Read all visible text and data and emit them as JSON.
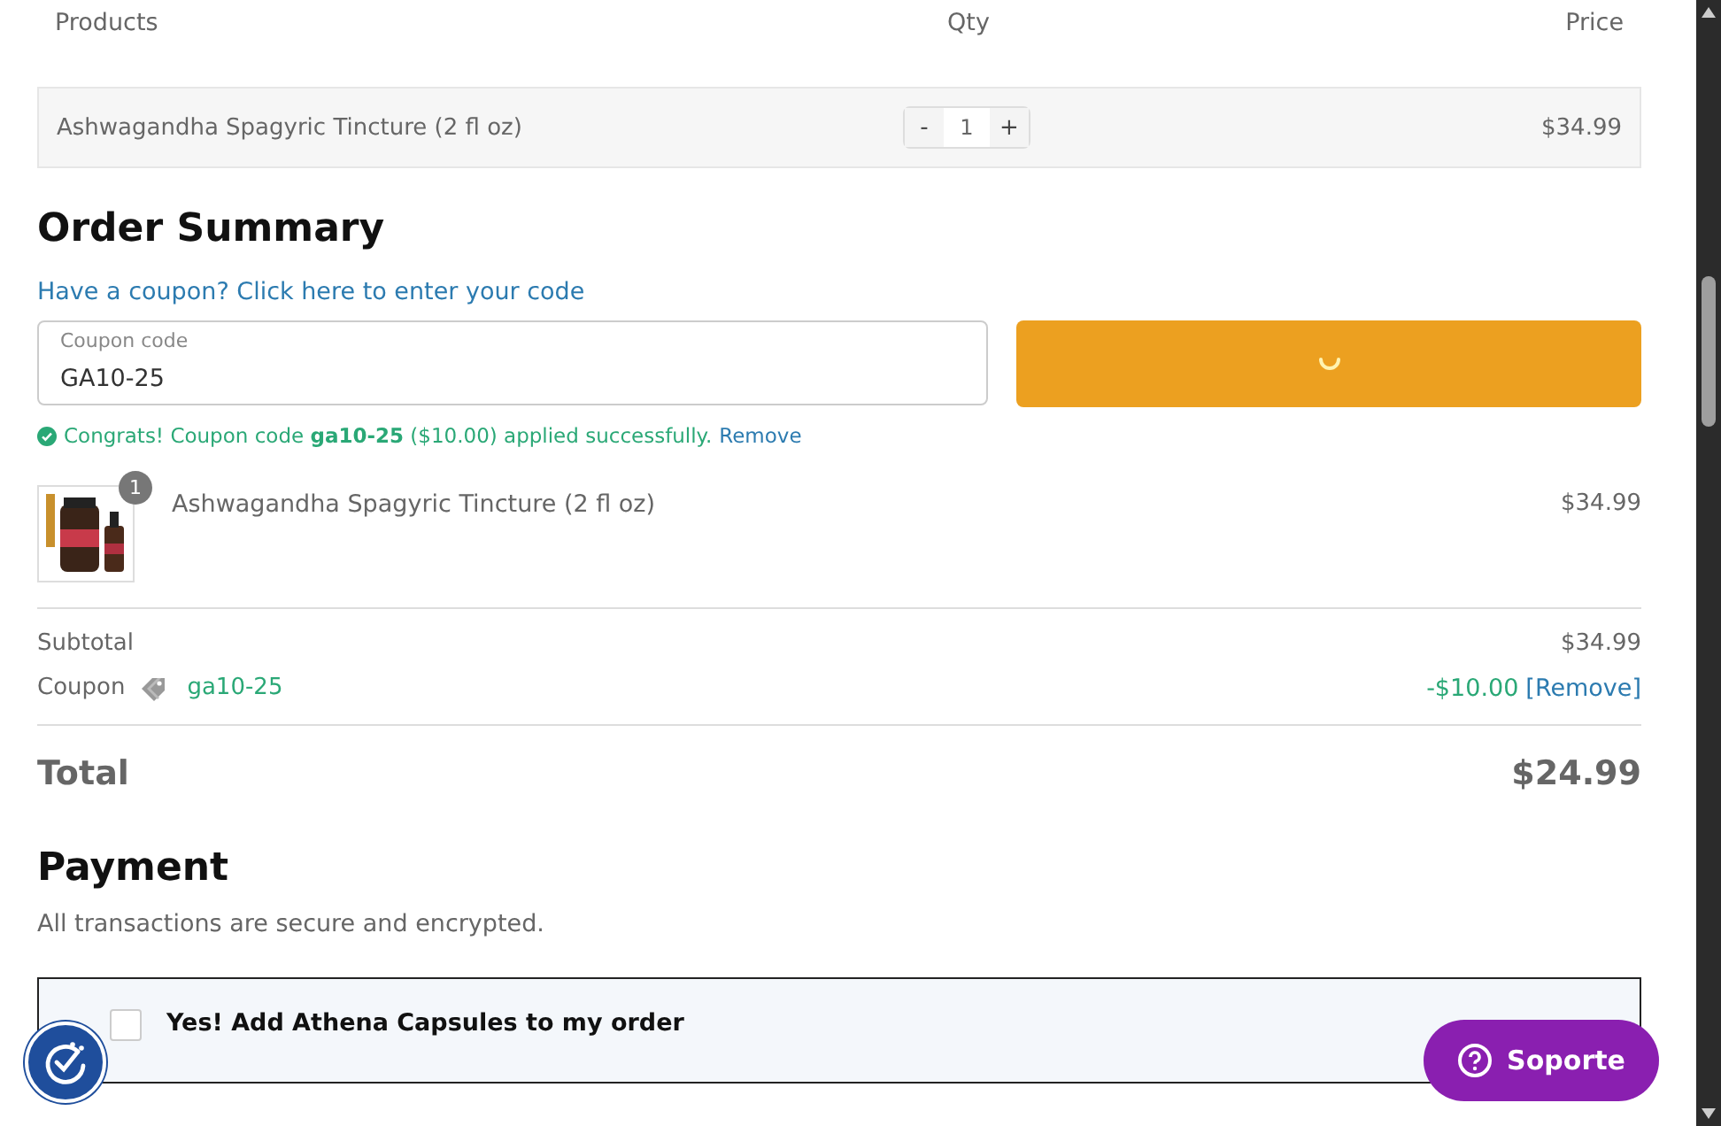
{
  "cart_table": {
    "columns": [
      "Products",
      "Qty",
      "Price"
    ],
    "rows": [
      {
        "product": "Ashwagandha Spagyric Tincture (2 fl oz)",
        "decrement": "-",
        "quantity": "1",
        "increment": "+",
        "price": "$34.99"
      }
    ]
  },
  "order_summary": {
    "title": "Order Summary",
    "coupon_link": "Have a coupon? Click here to enter your code",
    "coupon_field": {
      "label": "Coupon code",
      "value": "GA10-25"
    },
    "apply_button": {
      "loading": true
    },
    "success_message": "Congrats! Coupon code **ga10-25** ($10.00) applied successfully.",
    "success_remove": "Remove",
    "items": [
      {
        "kind": "picture",
        "badge": "1",
        "name": "Ashwagandha Spagyric Tincture (2 fl oz)",
        "price": "$34.99"
      }
    ],
    "subtotal": {
      "label": "Subtotal",
      "value": "$34.99"
    },
    "coupon": {
      "label": "Coupon",
      "code": "ga10-25",
      "discount": "-$10.00",
      "remove": "[Remove]"
    },
    "total": {
      "label": "Total",
      "value": "$24.99"
    }
  },
  "payment": {
    "title": "Payment",
    "subtitle": "All transactions are secure and encrypted.",
    "upsell": {
      "label": "Yes! Add Athena Capsules to my order",
      "checked": false
    }
  },
  "support_button": {
    "label": "Soporte"
  }
}
